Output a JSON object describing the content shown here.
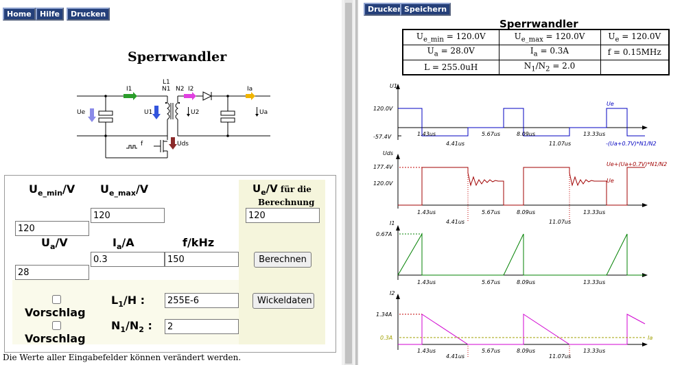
{
  "left_nav": {
    "home": "Home",
    "help": "Hilfe",
    "print": "Drucken"
  },
  "left_title": "Sperrwandler",
  "circuit": {
    "labels": {
      "l1": "L1",
      "n1": "N1",
      "n2": "N2",
      "i1": "I1",
      "i2": "I2",
      "ia": "Ia",
      "ue": "Ue",
      "u1": "U1",
      "u2": "U2",
      "ua": "Ua",
      "uds": "Uds",
      "f": "f"
    },
    "colors": {
      "i1": "#2a9d2a",
      "i2": "#e040e0",
      "ia": "#f0b400",
      "ue": "#8a8ae8",
      "u1": "#3355dd",
      "uds": "#8b2a2a"
    }
  },
  "form": {
    "ue_min": {
      "main": "U",
      "sub": "e_min",
      "unit": "/V",
      "value": "120"
    },
    "ue_max": {
      "main": "U",
      "sub": "e_max",
      "unit": "/V",
      "value": "120"
    },
    "ue": {
      "main": "U",
      "sub": "e",
      "unit": "/V",
      "suffix": " für die",
      "line2": "Berechnung",
      "value": "120"
    },
    "ua": {
      "main": "U",
      "sub": "a",
      "unit": "/V",
      "value": "28"
    },
    "ia": {
      "main": "I",
      "sub": "a",
      "unit": "/A",
      "value": "0.3"
    },
    "f": {
      "label": "f/kHz",
      "value": "150"
    },
    "l1": {
      "main": "L",
      "sub": "1",
      "unit": "/H :",
      "value": "255E-6"
    },
    "n": {
      "main": "N",
      "sub1": "1",
      "mid": "/N",
      "sub2": "2",
      "end": " :",
      "value": "2"
    },
    "suggest_label": "Vorschlag",
    "calc_button": "Berechnen",
    "winding_button": "Wickeldaten"
  },
  "footer_note": "Die Werte aller Eingabefelder können verändert werden.",
  "right_nav": {
    "print": "Drucken",
    "save": "Speichern"
  },
  "right_title": "Sperrwandler",
  "params": {
    "row1": [
      {
        "pre": "U",
        "sub": "e_min",
        "post": " = 120.0V"
      },
      {
        "pre": "U",
        "sub": "e_max",
        "post": " = 120.0V"
      },
      {
        "pre": "U",
        "sub": "e",
        "post": " = 120.0V"
      }
    ],
    "row2": [
      {
        "pre": "U",
        "sub": "a",
        "post": " = 28.0V"
      },
      {
        "pre": "I",
        "sub": "a",
        "post": " = 0.3A"
      },
      {
        "pre": "f = 0.15MHz",
        "sub": "",
        "post": ""
      }
    ],
    "row3": [
      {
        "pre": "L = 255.0uH",
        "sub": "",
        "post": ""
      },
      {
        "pre": "N",
        "sub": "1",
        "post": "/N"
      },
      {
        "pre": "",
        "sub": "",
        "post": ""
      }
    ],
    "n_ratio_sub2": "2",
    "n_ratio_value": " = 2.0"
  },
  "waveforms": {
    "colors": {
      "u1": "#0000c0",
      "uds": "#a00000",
      "i1": "#008000",
      "i2": "#d000d0",
      "ia": "#a0a000",
      "axis": "#000",
      "dotted": "#c00000"
    },
    "u1": {
      "axis_label": "U1",
      "level_high": "120.0V",
      "level_low": "-57.4V",
      "trace_high": "Ue",
      "trace_low": "-(Ua+0.7V)*N1/N2"
    },
    "uds": {
      "axis_label": "Uds",
      "level_high": "177.4V",
      "level_mid": "120.0V",
      "trace_high": "Ue+(Ua+0.7V)*N1/N2",
      "trace_mid": "Ue"
    },
    "i1": {
      "axis_label": "I1",
      "level": "0.67A"
    },
    "i2": {
      "axis_label": "I2",
      "level": "1.34A",
      "level_ia": "0.3A",
      "trace_ia": "Ia"
    },
    "times": [
      "1.43us",
      "4.41us",
      "5.67us",
      "8.09us",
      "11.07us",
      "13.33us"
    ]
  }
}
